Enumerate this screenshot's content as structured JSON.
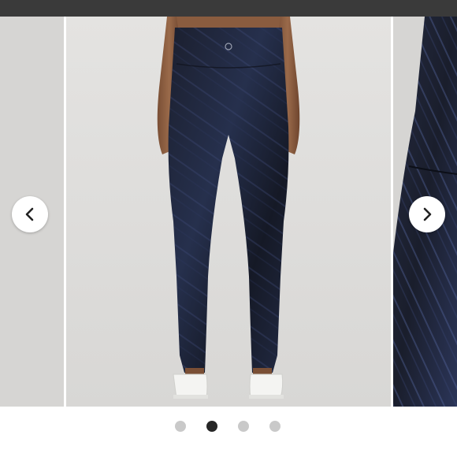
{
  "carousel": {
    "slide_count": 4,
    "active_index": 1,
    "images": [
      {
        "name": "previous-product-photo"
      },
      {
        "name": "leggings-back-view-photo"
      },
      {
        "name": "leggings-fabric-closeup-photo"
      }
    ],
    "controls": {
      "prev_icon": "chevron-left-icon",
      "next_icon": "chevron-right-icon"
    }
  },
  "colors": {
    "topbar": "#3a3a3a",
    "dot_active": "#262626",
    "dot_inactive": "#c9c9c9",
    "background": "#ffffff"
  }
}
